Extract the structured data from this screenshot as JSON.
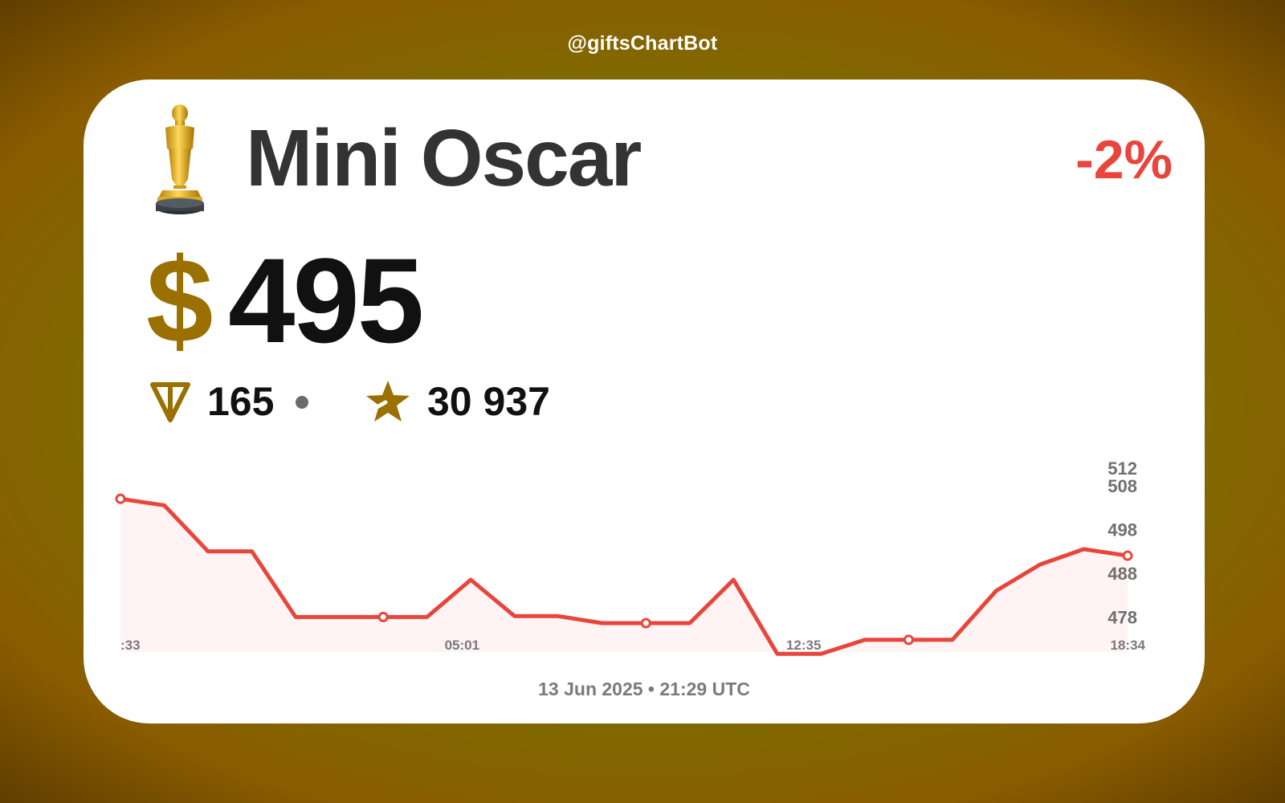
{
  "brand": {
    "handle": "@giftsChartBot"
  },
  "gift": {
    "name": "Mini Oscar",
    "icon": "oscar-statuette-icon",
    "change": "-2%",
    "change_color": "#e8453c"
  },
  "price": {
    "usd_symbol": "$",
    "usd_value": "495",
    "ton_icon": "ton-icon",
    "ton_value": "165",
    "stars_icon": "star-icon",
    "stars_value": "30 937",
    "accent_color": "#9a7000"
  },
  "footer": {
    "date": "13 Jun 2025 • 21:29 UTC"
  },
  "chart_data": {
    "type": "area",
    "line_color": "#e8453c",
    "fill_color": "#fff3f3",
    "grid": false,
    "legend": "none",
    "ylim": [
      470,
      512
    ],
    "y_ticks": [
      478,
      488,
      498,
      508,
      512
    ],
    "x_tick_labels": [
      ":33",
      "05:01",
      "12:35",
      "18:34"
    ],
    "values": [
      505,
      503.5,
      493,
      493,
      478,
      478,
      478,
      478,
      486.5,
      478.2,
      478.2,
      476.6,
      476.6,
      476.6,
      486.5,
      469.6,
      469.6,
      472.8,
      472.8,
      472.8,
      484,
      490,
      493.5,
      492
    ]
  }
}
